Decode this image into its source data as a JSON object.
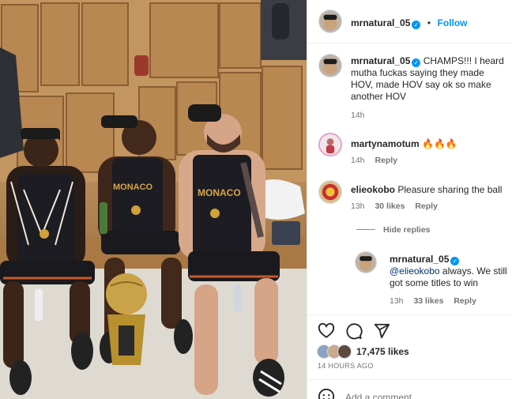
{
  "post": {
    "author": "mrnatural_05",
    "separator": "•",
    "follow_label": "Follow",
    "caption": {
      "author": "mrnatural_05",
      "text": "CHAMPS!!! I heard mutha fuckas saying they made HOV, made HOV say ok so make another HOV",
      "time": "14h"
    }
  },
  "comments": [
    {
      "user": "martynamotum",
      "text": "🔥🔥🔥",
      "time": "14h",
      "reply_label": "Reply"
    },
    {
      "user": "elieokobo",
      "text": "Pleasure sharing the ball",
      "time": "13h",
      "likes": "30 likes",
      "reply_label": "Reply"
    }
  ],
  "hide_replies_label": "Hide replies",
  "reply": {
    "user": "mrnatural_05",
    "mention": "@elieokobo",
    "text": " always. We still got some titles to win",
    "time": "13h",
    "likes": "33 likes",
    "reply_label": "Reply"
  },
  "actions": {
    "like_count": "17,475 likes",
    "posted": "14 HOURS AGO",
    "comment_placeholder": "Add a comment..."
  },
  "icons": [
    "verified-icon",
    "heart-icon",
    "comment-icon",
    "share-icon",
    "emoji-icon"
  ],
  "colors": {
    "accent": "#0095f6",
    "link": "#00376b",
    "muted": "#737373"
  }
}
